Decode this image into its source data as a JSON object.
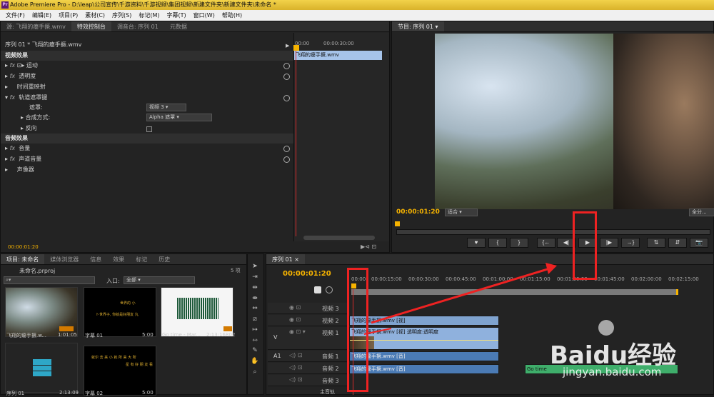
{
  "app": {
    "title": "Adobe Premiere Pro - D:\\leap\\公司宣传\\千游资料\\千游视频\\集团视频\\新建文件夹\\新建文件夹\\未命名 *",
    "logo": "Pr"
  },
  "menu": [
    "文件(F)",
    "编辑(E)",
    "项目(P)",
    "素材(C)",
    "序列(S)",
    "标记(M)",
    "字幕(T)",
    "窗口(W)",
    "帮助(H)"
  ],
  "effect_panel": {
    "tabs": [
      "源: 飞翔的瘪手撅.wmv",
      "特效控制台",
      "调音台: 序列 01",
      "元数据"
    ],
    "active_tab": 1,
    "clip_label": "序列 01 * 飞翔的瘪手撅.wmv",
    "video_effects_header": "视频效果",
    "motion": "运动",
    "opacity": "透明度",
    "time_remap": "时间重映射",
    "track_matte": "轨道遮罩键",
    "matte_label": "遮罩:",
    "matte_value": "视频 3",
    "composite_label": "合成方式:",
    "composite_value": "Alpha 遮罩",
    "reverse_label": "反向",
    "audio_effects_header": "音频效果",
    "volume": "音量",
    "channel_volume": "声道音量",
    "panner": "声像器",
    "ruler_start": "00:00",
    "ruler_mid": "00:00:30:00",
    "clip_name": "飞翔的瘪手撅.wmv",
    "timecode": "00:00:01:20"
  },
  "program_monitor": {
    "tab": "节目: 序列 01",
    "timecode": "00:00:01:20",
    "fit": "适合",
    "quality": "全分..."
  },
  "transport": [
    "♥",
    "{",
    "}",
    "{←",
    "◀|",
    "▶",
    "|▶",
    "→}",
    "⇅",
    "⇵",
    "📷"
  ],
  "project_panel": {
    "tabs": [
      "项目: 未命名",
      "媒体浏览器",
      "信息",
      "效果",
      "标记",
      "历史"
    ],
    "project_file": "未命名.prproj",
    "count": "5 项",
    "entry_label": "入口:",
    "entry_value": "全部",
    "items": [
      {
        "name": "飞翔的瘪手撅.w...",
        "dur": "1:01:05"
      },
      {
        "name": "字幕 01",
        "dur": "5:00"
      },
      {
        "name": "Go time - Mar...",
        "dur": "2:13:16802"
      },
      {
        "name": "序列 01",
        "dur": "2:13:09"
      },
      {
        "name": "字幕 02",
        "dur": "5:00"
      }
    ],
    "title1_lines": [
      "世界的 小",
      "ト世界子, 你就是好朋友 丸"
    ],
    "title2_lines": [
      "就尔 去 来 小 就 所 来 大 所",
      "星 有 好 朋 友 看"
    ]
  },
  "timeline": {
    "tab": "序列 01",
    "timecode": "00:00:01:20",
    "ruler": [
      "00:00",
      "00:00:15:00",
      "00:00:30:00",
      "00:00:45:00",
      "00:01:00:00",
      "00:01:15:00",
      "00:01:30:00",
      "00:01:45:00",
      "00:02:00:00",
      "00:02:15:00"
    ],
    "tracks": [
      "视频 3",
      "视频 2",
      "视频 1",
      "音频 1",
      "音频 2",
      "音频 3",
      "主音轨"
    ],
    "v_label": "V",
    "a_label": "A1",
    "clip_v3": "飞翔的瘪手撅.wmv [视]",
    "clip_v1": "飞翔的瘪手撅.wmv [视] 透明度:透明度",
    "clip_a1": "飞翔的瘪手撅.wmv [音]",
    "clip_a2": "飞翔的瘪手撅.wmv [音]",
    "clip_go": "Go time"
  },
  "watermark": {
    "brand": "Baidu经验",
    "url": "jingyan.baidu.com"
  },
  "colors": {
    "accent_timecode": "#f6b300",
    "blue_link": "#4aa7ff",
    "annotation_red": "#ee2222"
  }
}
